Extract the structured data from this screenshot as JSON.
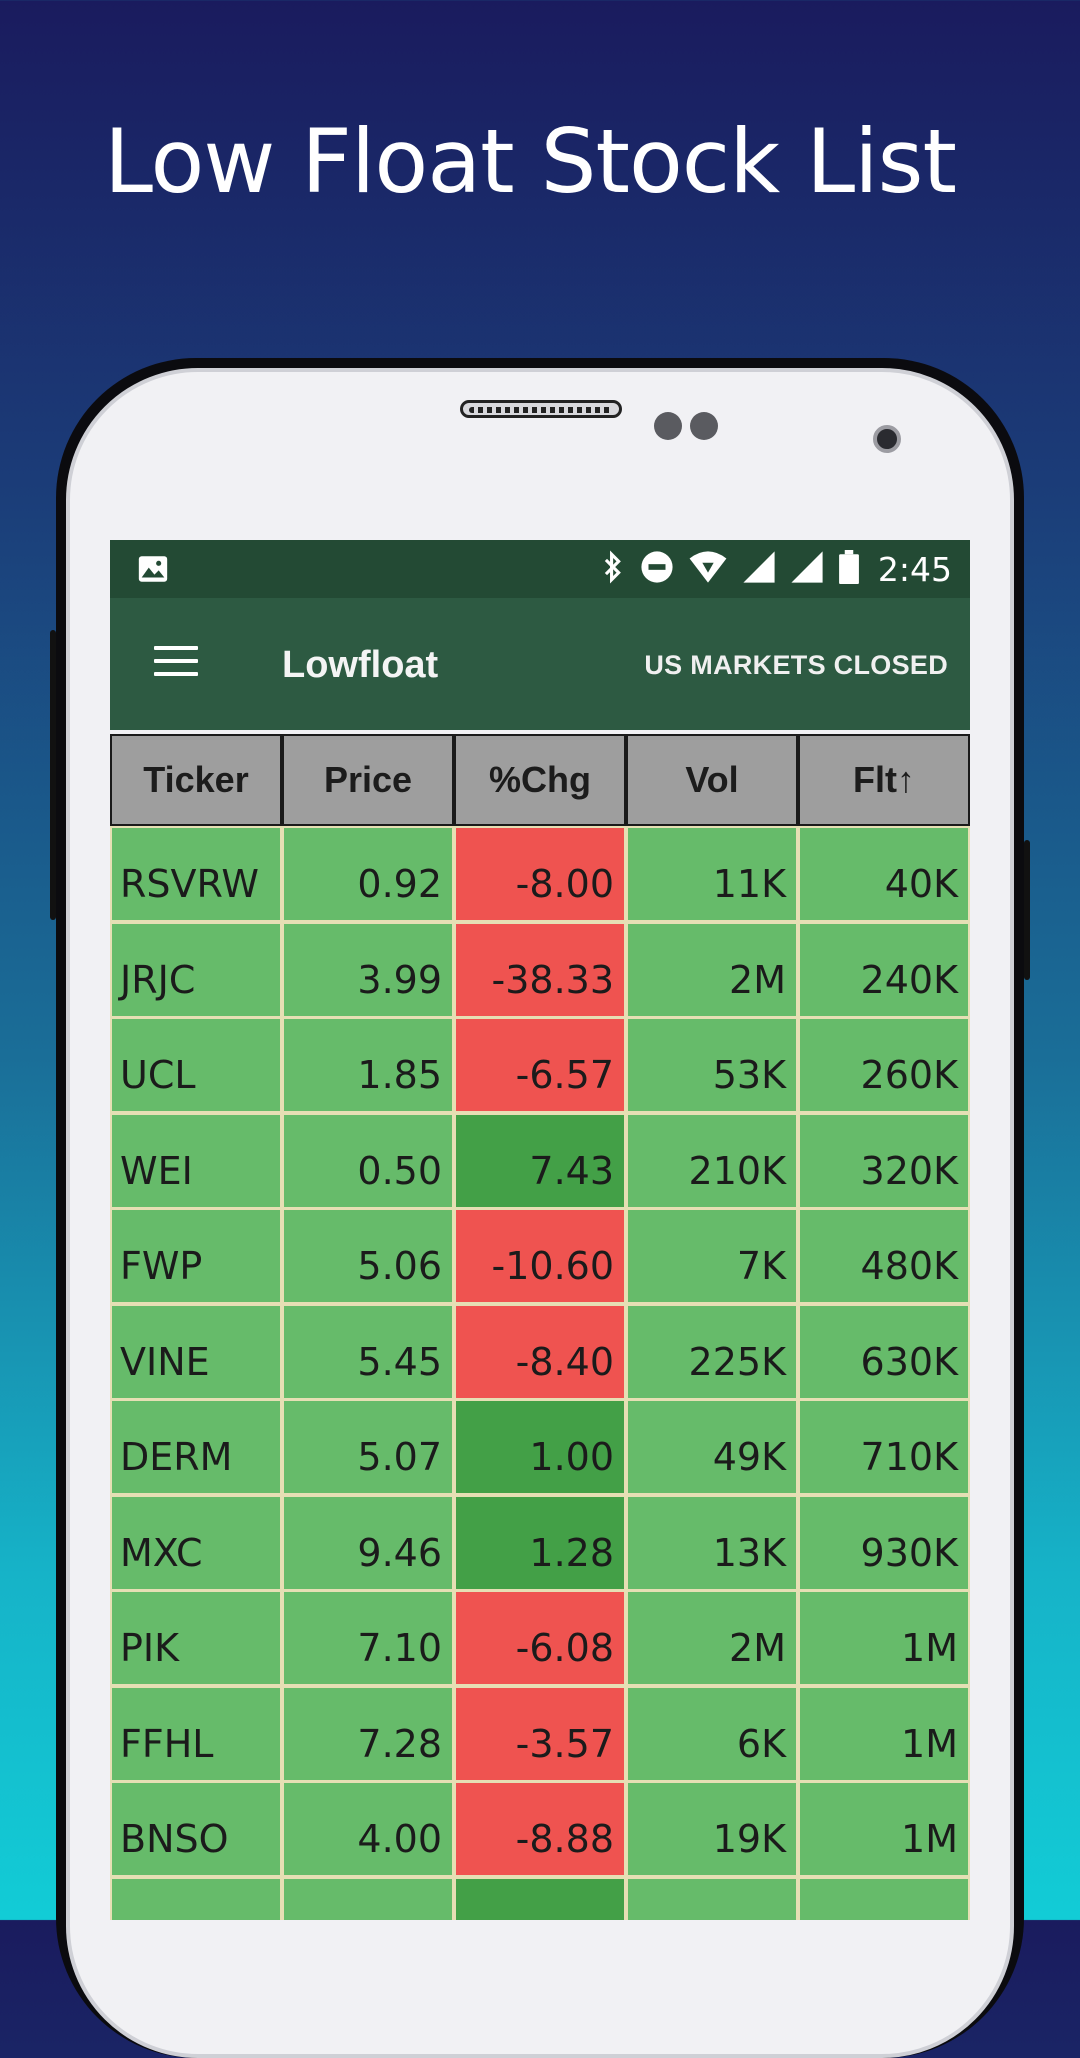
{
  "promo": {
    "title": "Low Float Stock List"
  },
  "status_bar": {
    "time": "2:45"
  },
  "app_bar": {
    "title": "Lowfloat",
    "market_status": "US MARKETS CLOSED"
  },
  "table": {
    "headers": [
      "Ticker",
      "Price",
      "%Chg",
      "Vol",
      "Flt↑"
    ],
    "rows": [
      {
        "ticker": "RSVRW",
        "price": "0.92",
        "chg": "-8.00",
        "vol": "11K",
        "flt": "40K",
        "dir": "neg"
      },
      {
        "ticker": "JRJC",
        "price": "3.99",
        "chg": "-38.33",
        "vol": "2M",
        "flt": "240K",
        "dir": "neg"
      },
      {
        "ticker": "UCL",
        "price": "1.85",
        "chg": "-6.57",
        "vol": "53K",
        "flt": "260K",
        "dir": "neg"
      },
      {
        "ticker": "WEI",
        "price": "0.50",
        "chg": "7.43",
        "vol": "210K",
        "flt": "320K",
        "dir": "pos"
      },
      {
        "ticker": "FWP",
        "price": "5.06",
        "chg": "-10.60",
        "vol": "7K",
        "flt": "480K",
        "dir": "neg"
      },
      {
        "ticker": "VINE",
        "price": "5.45",
        "chg": "-8.40",
        "vol": "225K",
        "flt": "630K",
        "dir": "neg"
      },
      {
        "ticker": "DERM",
        "price": "5.07",
        "chg": "1.00",
        "vol": "49K",
        "flt": "710K",
        "dir": "pos"
      },
      {
        "ticker": "MXC",
        "price": "9.46",
        "chg": "1.28",
        "vol": "13K",
        "flt": "930K",
        "dir": "pos"
      },
      {
        "ticker": "PIK",
        "price": "7.10",
        "chg": "-6.08",
        "vol": "2M",
        "flt": "1M",
        "dir": "neg"
      },
      {
        "ticker": "FFHL",
        "price": "7.28",
        "chg": "-3.57",
        "vol": "6K",
        "flt": "1M",
        "dir": "neg"
      },
      {
        "ticker": "BNSO",
        "price": "4.00",
        "chg": "-8.88",
        "vol": "19K",
        "flt": "1M",
        "dir": "neg"
      },
      {
        "ticker": "",
        "price": "",
        "chg": "",
        "vol": "",
        "flt": "",
        "dir": "pos"
      }
    ]
  },
  "colors": {
    "cell_green": "#66bb6a",
    "positive_change": "#43a047",
    "negative_change": "#ef5350",
    "app_bar": "#2d5a42",
    "status_bar": "#234a34"
  }
}
